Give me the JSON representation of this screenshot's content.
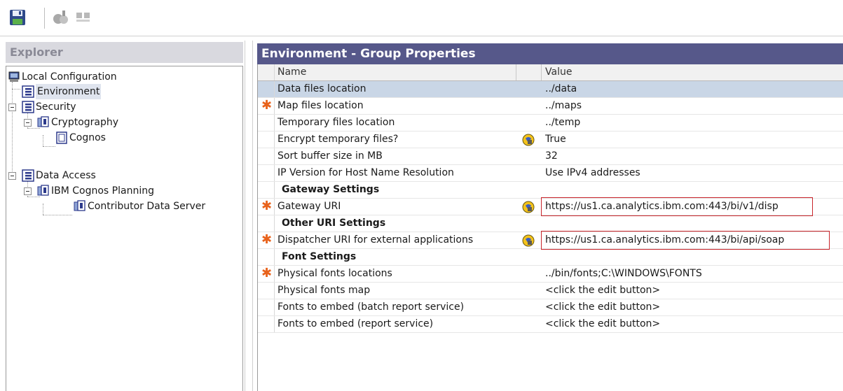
{
  "toolbar": {
    "save_icon": "save-icon",
    "test_icon": "test-icon",
    "grid_icon": "grid-icon"
  },
  "explorer": {
    "title": "Explorer",
    "tree": [
      {
        "label": "Local Configuration",
        "icon": "computer-icon"
      },
      {
        "label": "Environment",
        "icon": "group-icon",
        "selected": true
      },
      {
        "label": "Security",
        "icon": "group-icon"
      },
      {
        "label": "Cryptography",
        "icon": "component-icon"
      },
      {
        "label": "Cognos",
        "icon": "provider-icon"
      },
      {
        "label": "Data Access",
        "icon": "group-icon"
      },
      {
        "label": "IBM Cognos Planning",
        "icon": "component-icon"
      },
      {
        "label": "Contributor Data Server",
        "icon": "component-icon"
      }
    ]
  },
  "properties": {
    "title": "Environment - Group Properties",
    "columns": {
      "name": "Name",
      "value": "Value"
    },
    "rows": [
      {
        "name": "Data files location",
        "value": "../data"
      },
      {
        "name": "Map files location",
        "value": "../maps",
        "required": true
      },
      {
        "name": "Temporary files location",
        "value": "../temp"
      },
      {
        "name": "Encrypt temporary files?",
        "value": "True",
        "icon": "test-icon"
      },
      {
        "name": "Sort buffer size in MB",
        "value": "32"
      },
      {
        "name": "IP Version for Host Name Resolution",
        "value": "Use IPv4 addresses"
      },
      {
        "section": "Gateway Settings"
      },
      {
        "name": "Gateway URI",
        "value": "https://us1.ca.analytics.ibm.com:443/bi/v1/disp",
        "required": true,
        "icon": "test-icon",
        "highlighted": true
      },
      {
        "section": "Other URI Settings"
      },
      {
        "name": "Dispatcher URI for external applications",
        "value": "https://us1.ca.analytics.ibm.com:443/bi/api/soap",
        "required": true,
        "icon": "test-icon",
        "highlighted": true
      },
      {
        "section": "Font Settings"
      },
      {
        "name": "Physical fonts locations",
        "value": "../bin/fonts;C:\\WINDOWS\\FONTS",
        "required": true
      },
      {
        "name": "Physical fonts map",
        "value": "<click the edit button>"
      },
      {
        "name": "Fonts to embed (batch report service)",
        "value": "<click the edit button>"
      },
      {
        "name": "Fonts to embed (report service)",
        "value": "<click the edit button>"
      }
    ]
  },
  "colors": {
    "header_bg": "#56588a",
    "selected_row": "#c9d6e6",
    "required_star": "#e8621b",
    "highlight_border": "#c8252b"
  }
}
